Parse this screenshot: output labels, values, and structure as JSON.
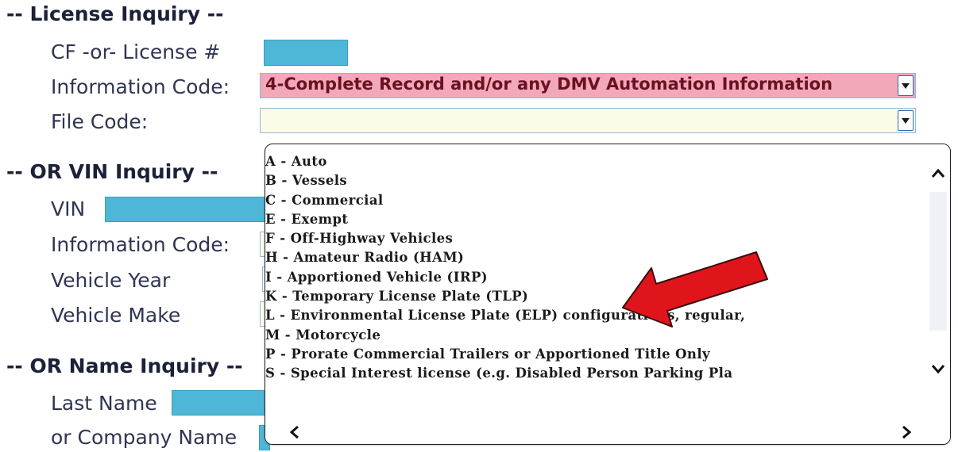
{
  "license_inquiry": {
    "title": "-- License Inquiry --",
    "cf_license_label": "CF -or- License #",
    "info_code_label": "Information Code:",
    "info_code_value": "4-Complete Record and/or any DMV Automation Information",
    "file_code_label": "File Code:",
    "file_code_value": ""
  },
  "vin_inquiry": {
    "title": "-- OR VIN Inquiry --",
    "vin_label": "VIN",
    "info_code_label": "Information Code:",
    "vehicle_year_label": "Vehicle Year",
    "vehicle_make_label": "Vehicle Make"
  },
  "name_inquiry": {
    "title": "-- OR Name Inquiry --",
    "last_name_label": "Last Name",
    "company_name_label": "or Company Name"
  },
  "file_code_options": [
    "A - Auto",
    "B - Vessels",
    "C - Commercial",
    "E - Exempt",
    "F - Off-Highway Vehicles",
    "H - Amateur Radio (HAM)",
    "I - Apportioned Vehicle (IRP)",
    "K - Temporary License Plate (TLP)",
    "L - Environmental License Plate (ELP) configurations, regular,",
    "M - Motorcycle",
    "P - Prorate Commercial Trailers or Apportioned Title Only",
    "S - Special Interest license (e.g. Disabled Person Parking Pla"
  ],
  "icons": {
    "dropdown_arrow": "chevron-down-icon",
    "scroll_up": "chevron-up-icon",
    "scroll_down": "chevron-down-icon",
    "scroll_left": "chevron-left-icon",
    "scroll_right": "chevron-right-icon",
    "annotation": "red-arrow-icon"
  },
  "colors": {
    "field_fill": "#4eb6d6",
    "selected_fill": "#f2a8b8",
    "empty_select_fill": "#fbfbe8",
    "annotation_red": "#e0151b"
  }
}
